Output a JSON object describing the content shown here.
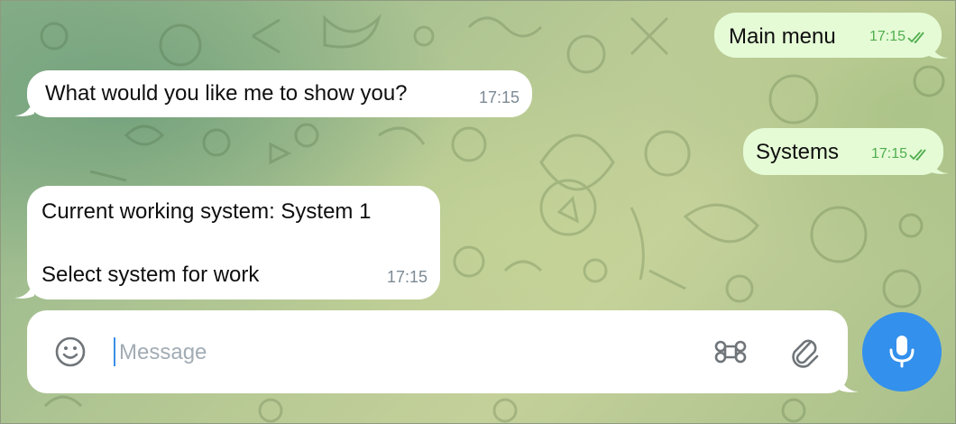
{
  "messages": [
    {
      "id": "main-menu",
      "direction": "out",
      "text": "Main menu",
      "time": "17:15",
      "status": "read"
    },
    {
      "id": "question",
      "direction": "in",
      "text": "What would you like me to show you?",
      "time": "17:15"
    },
    {
      "id": "systems",
      "direction": "out",
      "text": "Systems",
      "time": "17:15",
      "status": "read"
    },
    {
      "id": "current-system",
      "direction": "in",
      "lines": [
        "Current working system: System 1",
        "Select system for work"
      ],
      "time": "17:15"
    }
  ],
  "composer": {
    "placeholder": "Message",
    "value": "",
    "left_icons": [
      "emoji-icon"
    ],
    "right_icons": [
      "command-icon",
      "paperclip-icon"
    ]
  },
  "send_button": {
    "icon": "microphone-icon"
  },
  "colors": {
    "incoming_bubble": "#ffffff",
    "outgoing_bubble": "#e5fbd6",
    "outgoing_time": "#4fae4e",
    "incoming_time": "#7c8a94",
    "accent": "#3390ec"
  }
}
